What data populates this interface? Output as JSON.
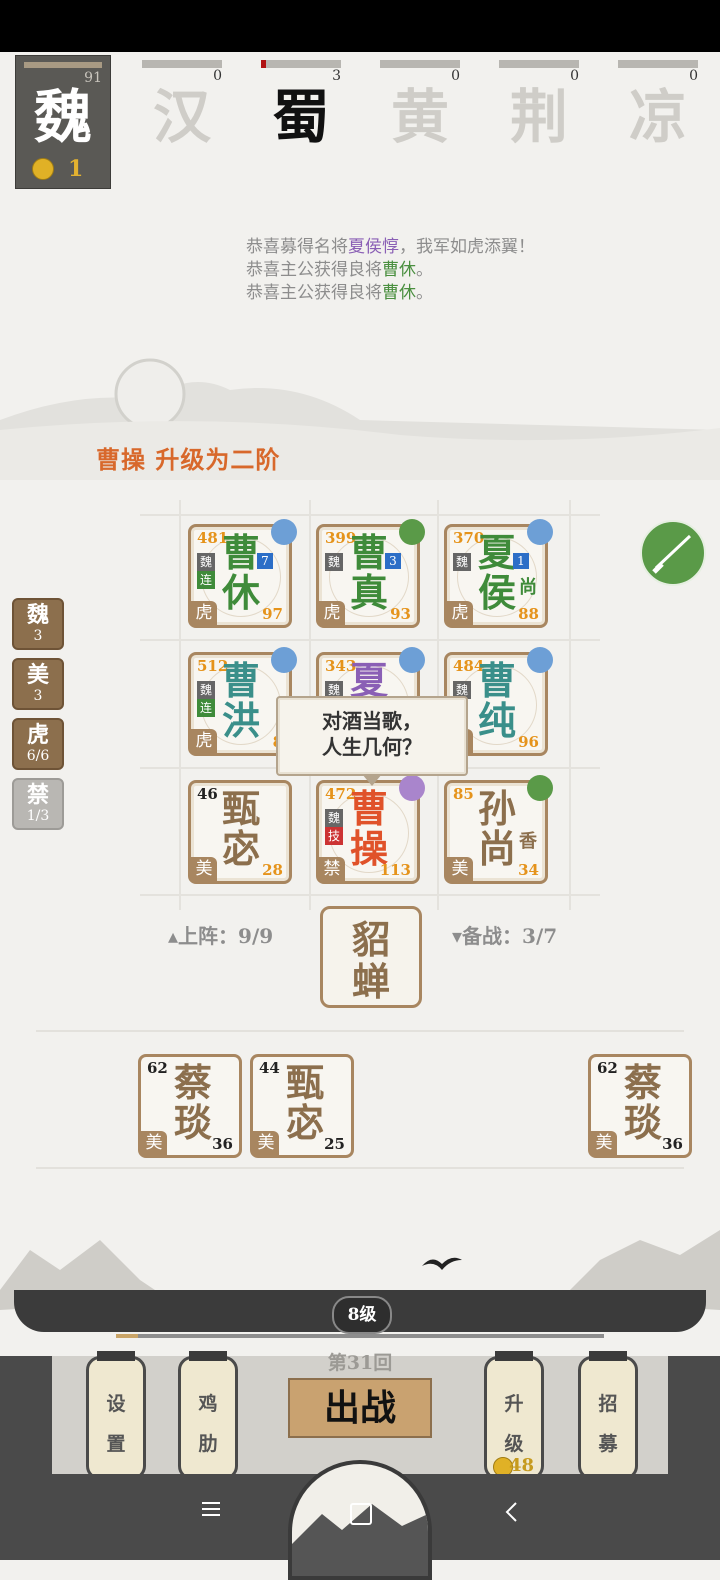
{
  "factions": [
    {
      "name": "魏",
      "count": "91",
      "coins": "1",
      "active": true
    },
    {
      "name": "汉",
      "count": "0"
    },
    {
      "name": "蜀",
      "count": "3"
    },
    {
      "name": "黄",
      "count": "0"
    },
    {
      "name": "荆",
      "count": "0"
    },
    {
      "name": "凉",
      "count": "0"
    }
  ],
  "messages": {
    "m1_pre": "恭喜募得名将",
    "m1_hero": "夏侯惇",
    "m1_post": "，我军如虎添翼！",
    "m2_pre": "恭喜主公获得良将",
    "m2_hero": "曹休",
    "m2_post": "。",
    "m3_pre": "恭喜主公获得良将",
    "m3_hero": "曹休",
    "m3_post": "。"
  },
  "upgrade_msg": "曹操  升级为二阶",
  "traits": [
    {
      "name": "魏",
      "count": "3"
    },
    {
      "name": "美",
      "count": "3"
    },
    {
      "name": "虎",
      "count": "6/6"
    },
    {
      "name": "禁",
      "count": "1/3"
    }
  ],
  "board": [
    {
      "id": "caoxiu",
      "line1": "曹",
      "line2": "休",
      "atk": "481",
      "hp": "97",
      "trait": "虎",
      "fac": "魏",
      "lian": "连",
      "star": "7",
      "color": "#3f8b3a"
    },
    {
      "id": "caozhen",
      "line1": "曹",
      "line2": "真",
      "atk": "399",
      "hp": "93",
      "trait": "虎",
      "fac": "魏",
      "star": "3",
      "color": "#3f8b3a"
    },
    {
      "id": "xiahou",
      "line1": "夏",
      "line2": "侯",
      "atk": "370",
      "hp": "88",
      "trait": "虎",
      "fac": "魏",
      "star": "1",
      "side": "尚",
      "color": "#3f8b3a"
    },
    {
      "id": "caohong",
      "line1": "曹",
      "line2": "洪",
      "atk": "512",
      "hp": "8",
      "trait": "虎",
      "fac": "魏",
      "lian": "连",
      "color": "#3a8f8a"
    },
    {
      "id": "hidden",
      "line1": "夏",
      "line2": "",
      "atk": "343",
      "hp": "",
      "trait": "",
      "fac": "魏",
      "color": "#8a5fb5"
    },
    {
      "id": "caochun",
      "line1": "曹",
      "line2": "纯",
      "atk": "484",
      "hp": "96",
      "trait": "虎",
      "fac": "魏",
      "color": "#3a8f8a"
    },
    {
      "id": "zhenmi",
      "line1": "甄",
      "line2": "宓",
      "atk": "46",
      "hp": "28",
      "trait": "美",
      "color": "#8c6f4d"
    },
    {
      "id": "caocao",
      "line1": "曹",
      "line2": "操",
      "atk": "472",
      "hp": "113",
      "trait": "禁",
      "fac": "魏",
      "lian": "技",
      "color": "#e0522a"
    },
    {
      "id": "sunshang",
      "line1": "孙",
      "line2": "尚",
      "atk": "85",
      "hp": "34",
      "trait": "美",
      "side": "香",
      "color": "#8c6f4d"
    }
  ],
  "bubble": {
    "line1": "对酒当歌，",
    "line2": "人生几何？"
  },
  "deploy": "▴上阵：9/9",
  "reserve": "▾备战：3/7",
  "featured": {
    "line1": "貂",
    "line2": "蝉"
  },
  "bench": [
    {
      "line1": "蔡",
      "line2": "琰",
      "atk": "62",
      "hp": "36",
      "trait": "美"
    },
    {
      "line1": "甄",
      "line2": "宓",
      "atk": "44",
      "hp": "25",
      "trait": "美"
    },
    {
      "line1": "蔡",
      "line2": "琰",
      "atk": "62",
      "hp": "36",
      "trait": "美"
    }
  ],
  "bottom": {
    "level": "8级",
    "round": "第31回",
    "fight": "出战",
    "settings": [
      "设",
      "置"
    ],
    "cheer": [
      "鸡",
      "肋"
    ],
    "upgrade": [
      "升",
      "级"
    ],
    "upgrade_cost": "48",
    "recruit": [
      "招",
      "募"
    ]
  },
  "colors": {
    "accent": "#d8682b",
    "gold": "#e0b126",
    "brown": "#a88660",
    "green": "#3f8b3a"
  }
}
